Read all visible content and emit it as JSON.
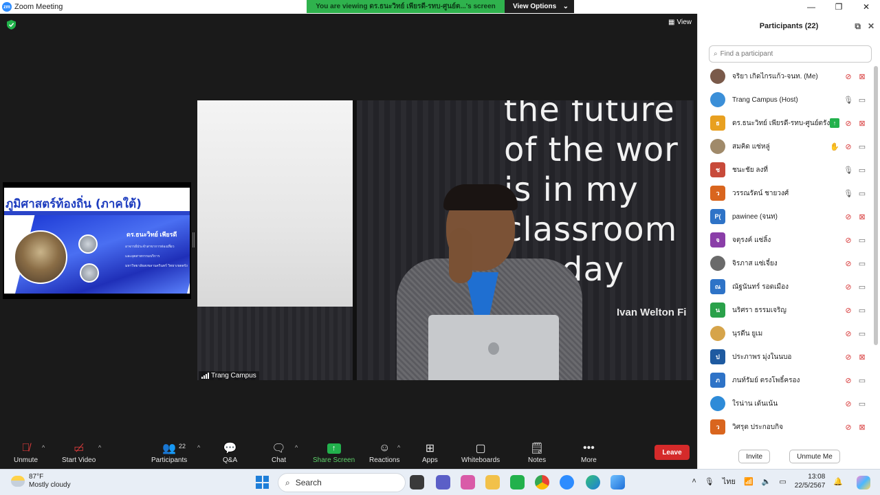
{
  "window": {
    "title": "Zoom Meeting",
    "logo": "zm",
    "minimize": "—",
    "restore": "❐",
    "close": "✕"
  },
  "share_banner": {
    "text": "You are viewing ดร.ธนะวิทย์ เพียรดี-รทบ-ศูนย์ต...'s screen",
    "view_options": "View Options"
  },
  "meeting": {
    "view_label": "View",
    "thumbnail": {
      "slide_title": "ภูมิศาสตร์ท้องถิ่น (ภาคใต้)",
      "slide_name": "ดร.ธนะวิทย์ เพียรดี",
      "slide_lines": [
        "อาจารย์ประจำสาขาการท่องเที่ยว",
        "และอุตสาหกรรมบริการ",
        "มหาวิทยาลัยสงขลานครินทร์ วิทยาเขตตรัง"
      ]
    },
    "main_video": {
      "wall_lines": [
        "the future",
        "of the wor",
        "is in my",
        "classroom",
        "day"
      ],
      "wall_sign": "Ivan Welton Fi",
      "label": "Trang Campus"
    }
  },
  "toolbar": {
    "unmute": "Unmute",
    "start_video": "Start Video",
    "participants": "Participants",
    "participants_count": "22",
    "qa": "Q&A",
    "chat": "Chat",
    "share_screen": "Share Screen",
    "reactions": "Reactions",
    "apps": "Apps",
    "whiteboards": "Whiteboards",
    "notes": "Notes",
    "more": "More",
    "leave": "Leave"
  },
  "panel": {
    "title": "Participants (22)",
    "search_placeholder": "Find a participant",
    "invite": "Invite",
    "unmute_me": "Unmute Me",
    "participants": [
      {
        "name": "จริยา เกิดไกรแก้ว-จนท. (Me)",
        "initial": "",
        "color": "#7a5a4a",
        "mic": "muted",
        "video": "off",
        "extra": ""
      },
      {
        "name": "Trang Campus (Host)",
        "initial": "",
        "color": "#3b8fd8",
        "mic": "on",
        "video": "on",
        "extra": ""
      },
      {
        "name": "ดร.ธนะวิทย์ เพียรดี-รทบ-ศูนย์ตรัง",
        "initial": "ธ",
        "color": "#e8a020",
        "mic": "muted",
        "video": "off",
        "extra": "share"
      },
      {
        "name": "สมคิด แซ่หลู่",
        "initial": "",
        "color": "#a08a6a",
        "mic": "muted",
        "video": "on",
        "extra": "hand"
      },
      {
        "name": "ชนะชัย ลงที่",
        "initial": "ช",
        "color": "#c84a3a",
        "mic": "on",
        "video": "on",
        "extra": ""
      },
      {
        "name": "วรรณรัตน์ ชายวงศ์",
        "initial": "ว",
        "color": "#d9651e",
        "mic": "on",
        "video": "on",
        "extra": ""
      },
      {
        "name": "pawinee (จนท)",
        "initial": "P(",
        "color": "#2e73c7",
        "mic": "muted",
        "video": "off",
        "extra": ""
      },
      {
        "name": "จตุรงค์ แซ่ลิ้ง",
        "initial": "จ",
        "color": "#8a3ea8",
        "mic": "muted",
        "video": "on",
        "extra": ""
      },
      {
        "name": "จิรภาส แซ่เจี๋ยง",
        "initial": "",
        "color": "#6a6a6a",
        "mic": "muted",
        "video": "on",
        "extra": ""
      },
      {
        "name": "ณัฐนันทร์ รอดเมือง",
        "initial": "ณ",
        "color": "#2e73c7",
        "mic": "muted",
        "video": "on",
        "extra": ""
      },
      {
        "name": "นริศรา ธรรมเจริญ",
        "initial": "น",
        "color": "#2aa14a",
        "mic": "muted",
        "video": "on",
        "extra": ""
      },
      {
        "name": "นุรดีน ยูเม",
        "initial": "",
        "color": "#d6a44a",
        "mic": "muted",
        "video": "on",
        "extra": ""
      },
      {
        "name": "ประภาพร มุ่งในนบอ",
        "initial": "ป",
        "color": "#1e5aa0",
        "mic": "muted",
        "video": "off",
        "extra": ""
      },
      {
        "name": "ภนท์รัมย์ ตรงโพธิ์ครอง",
        "initial": "ภ",
        "color": "#2e73c7",
        "mic": "muted",
        "video": "on",
        "extra": ""
      },
      {
        "name": "ใรน่าน เด้นเน้น",
        "initial": "",
        "color": "#2e8bd8",
        "mic": "muted",
        "video": "on",
        "extra": ""
      },
      {
        "name": "วิศรุต ประกอบกิจ",
        "initial": "ว",
        "color": "#d9651e",
        "mic": "muted",
        "video": "off",
        "extra": ""
      }
    ]
  },
  "taskbar": {
    "temperature": "87°F",
    "weather": "Mostly cloudy",
    "search": "Search",
    "language": "ไทย",
    "time": "13:08",
    "date": "22/5/2567"
  }
}
